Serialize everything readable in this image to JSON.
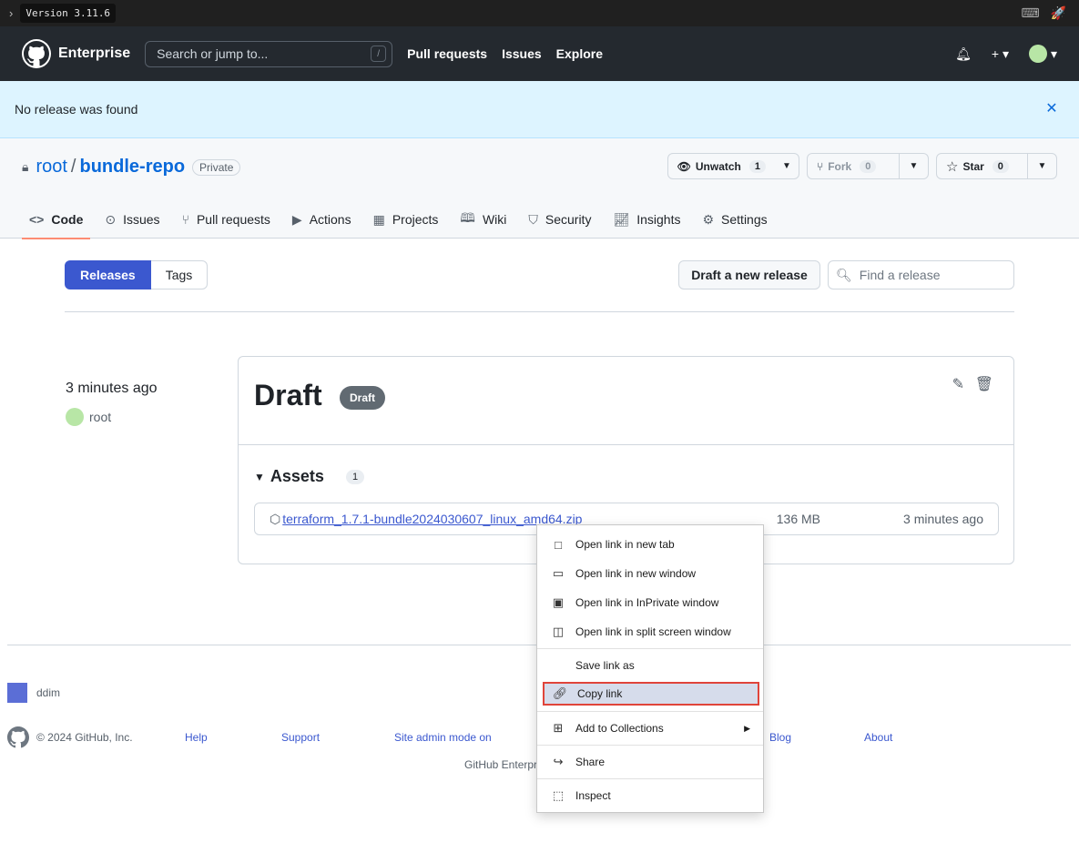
{
  "topbar": {
    "version": "Version 3.11.6"
  },
  "header": {
    "brand": "Enterprise",
    "search_placeholder": "Search or jump to...",
    "search_key": "/",
    "nav": [
      "Pull requests",
      "Issues",
      "Explore"
    ]
  },
  "flash": {
    "message": "No release was found"
  },
  "repo": {
    "owner": "root",
    "separator": "/",
    "name": "bundle-repo",
    "visibility": "Private",
    "watch": {
      "label": "Unwatch",
      "count": "1"
    },
    "fork": {
      "label": "Fork",
      "count": "0"
    },
    "star": {
      "label": "Star",
      "count": "0"
    },
    "tabs": [
      "Code",
      "Issues",
      "Pull requests",
      "Actions",
      "Projects",
      "Wiki",
      "Security",
      "Insights",
      "Settings"
    ]
  },
  "releases_nav": {
    "releases": "Releases",
    "tags": "Tags",
    "draft_button": "Draft a new release",
    "find_placeholder": "Find a release"
  },
  "release": {
    "time": "3 minutes ago",
    "author": "root",
    "title": "Draft",
    "badge": "Draft",
    "assets_label": "Assets",
    "assets_count": "1",
    "asset": {
      "name": "terraform_1.7.1-bundle2024030607_linux_amd64.zip",
      "size": "136 MB",
      "time": "3 minutes ago"
    }
  },
  "footer": {
    "user": "ddim",
    "copyright": "© 2024 GitHub, Inc.",
    "links": [
      "Help",
      "Support",
      "Site admin mode on",
      "Blog",
      "About"
    ],
    "line2": "GitHub Enterpr"
  },
  "context_menu": {
    "items": [
      "Open link in new tab",
      "Open link in new window",
      "Open link in InPrivate window",
      "Open link in split screen window",
      "Save link as",
      "Copy link",
      "Add to Collections",
      "Share",
      "Inspect"
    ]
  },
  "colors": {
    "accent": "#3b58cf",
    "header_bg": "#24292f",
    "flash_bg": "#ddf4ff",
    "tab_underline": "#fd8c73",
    "menu_highlight": "#e0443a"
  }
}
